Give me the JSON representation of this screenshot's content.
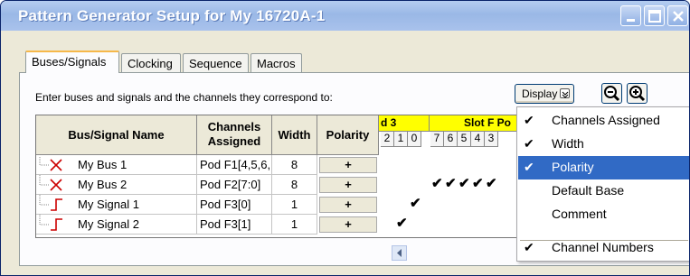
{
  "window": {
    "title": "Pattern Generator Setup for My 16720A-1"
  },
  "tabs": [
    "Buses/Signals",
    "Clocking",
    "Sequence",
    "Macros"
  ],
  "instruction": "Enter buses and signals and the channels they correspond to:",
  "toolbar": {
    "display_label": "Display"
  },
  "table": {
    "headers": {
      "name": "Bus/Signal Name",
      "channels_l1": "Channels",
      "channels_l2": "Assigned",
      "width": "Width",
      "polarity": "Polarity"
    },
    "slots": [
      "d 3",
      "Slot F Po"
    ],
    "bits": [
      "2",
      "1",
      "0",
      "7",
      "6",
      "5",
      "4",
      "3"
    ],
    "rows": [
      {
        "name": "My Bus 1",
        "kind": "bus",
        "channels": "Pod F1[4,5,6,",
        "width": "8",
        "polarity": "+"
      },
      {
        "name": "My Bus 2",
        "kind": "bus",
        "channels": "Pod F2[7:0]",
        "width": "8",
        "polarity": "+"
      },
      {
        "name": "My Signal 1",
        "kind": "signal",
        "channels": "Pod F3[0]",
        "width": "1",
        "polarity": "+"
      },
      {
        "name": "My Signal 2",
        "kind": "signal",
        "channels": "Pod F3[1]",
        "width": "1",
        "polarity": "+"
      }
    ]
  },
  "menu": {
    "items": [
      {
        "label": "Channels Assigned",
        "checked": true,
        "highlighted": false
      },
      {
        "label": "Width",
        "checked": true,
        "highlighted": false
      },
      {
        "label": "Polarity",
        "checked": true,
        "highlighted": true
      },
      {
        "label": "Default Base",
        "checked": false,
        "highlighted": false
      },
      {
        "label": "Comment",
        "checked": false,
        "highlighted": false
      },
      {
        "label": "Channel Numbers",
        "checked": true,
        "highlighted": false
      }
    ],
    "check_glyph": "✔"
  },
  "colors": {
    "bus_icon": "#cc0000",
    "slot_header": "#ffff00",
    "menu_highlight": "#316ac5",
    "title_bar": "#9ab8e6"
  },
  "icons": [
    "minimize-icon",
    "maximize-icon",
    "close-icon",
    "zoom-out-icon",
    "zoom-in-icon",
    "chevron-down-icon",
    "scroll-left-icon"
  ]
}
